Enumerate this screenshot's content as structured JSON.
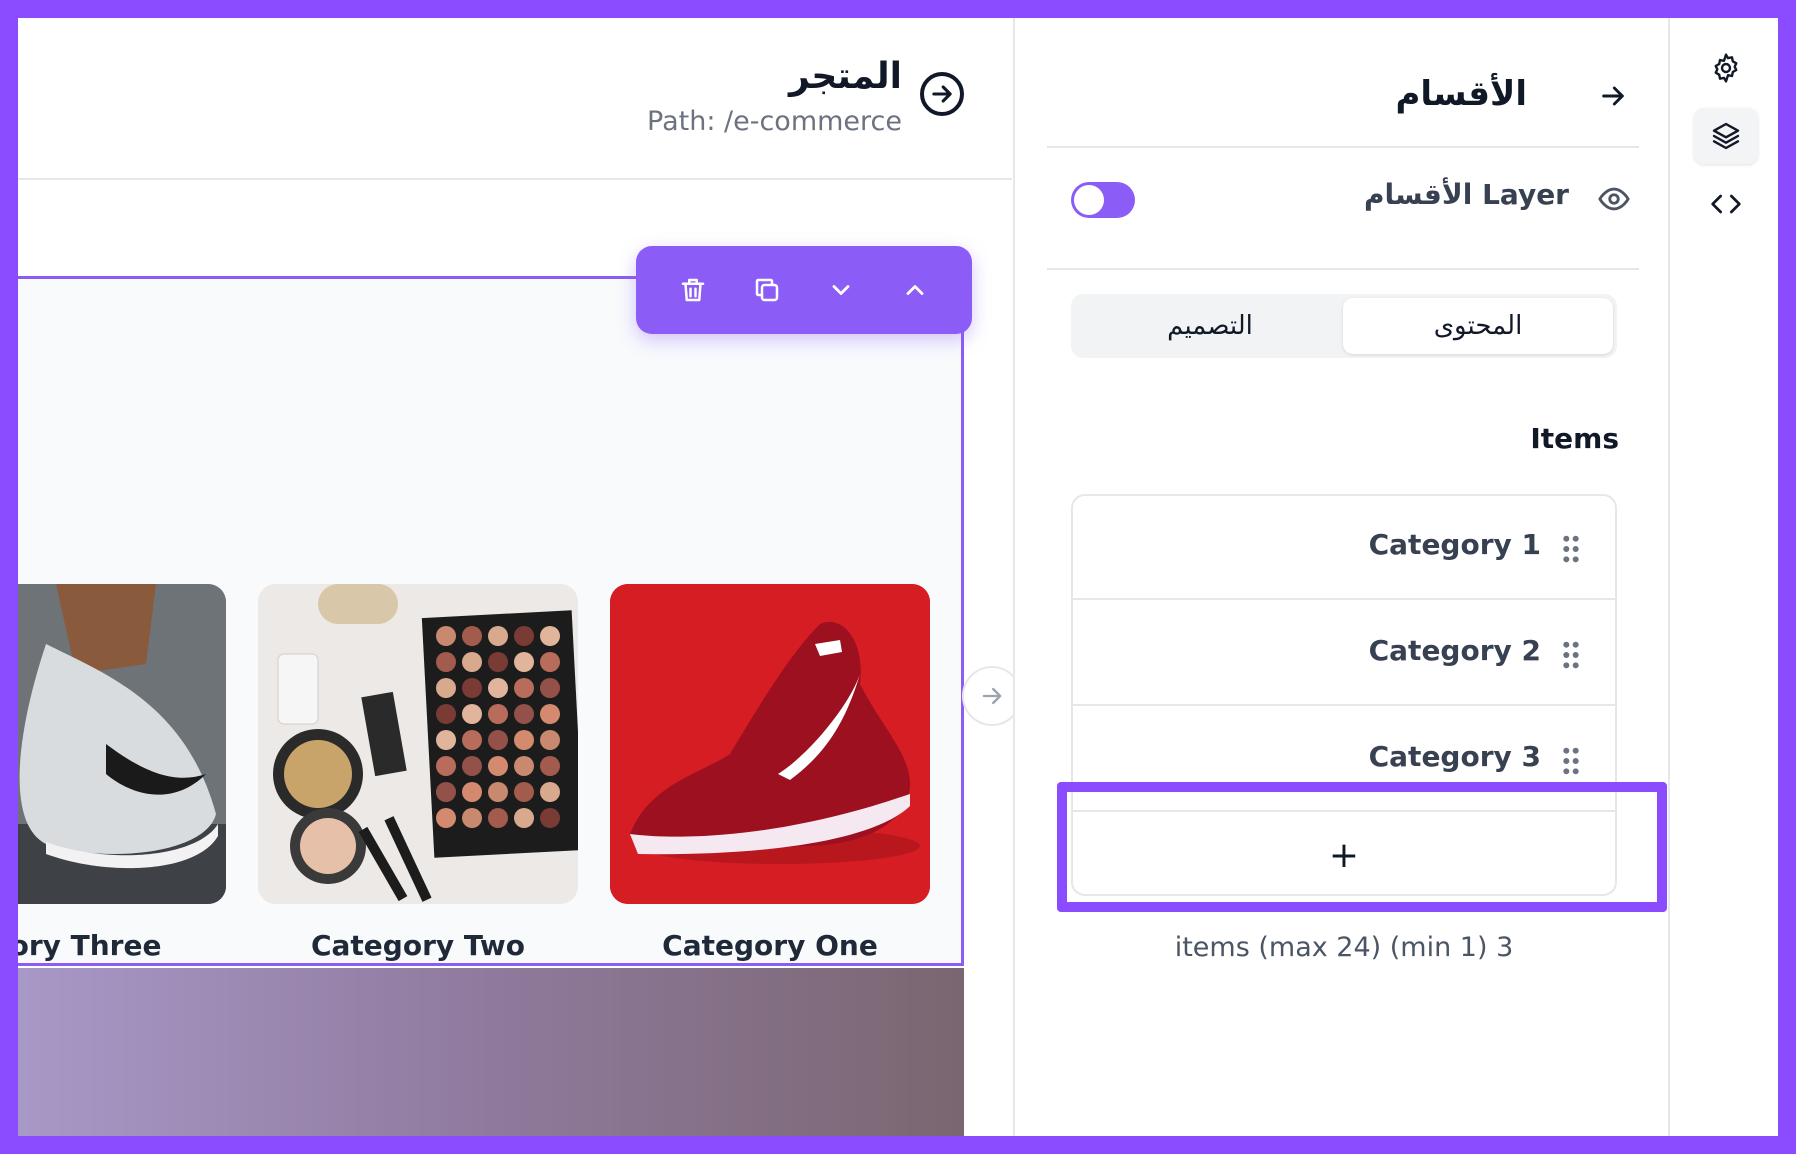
{
  "header": {
    "title": "المتجر",
    "path": "Path: /e-commerce"
  },
  "toolbar": {
    "icons": [
      "trash-icon",
      "copy-icon",
      "chevron-down-icon",
      "chevron-up-icon"
    ]
  },
  "categories": [
    {
      "label": "Category One",
      "image": "red-sneaker"
    },
    {
      "label": "Category Two",
      "image": "makeup-palette"
    },
    {
      "label": "egory Three",
      "image": "gray-sneaker"
    }
  ],
  "panel": {
    "title": "الأقسام",
    "layer_label": "Layer الأقسام",
    "toggle_on": true,
    "tabs": [
      {
        "label": "المحتوى",
        "active": true
      },
      {
        "label": "التصميم",
        "active": false
      }
    ],
    "items_label": "Items",
    "items": [
      {
        "label": "Category 1"
      },
      {
        "label": "Category 2"
      },
      {
        "label": "Category 3"
      }
    ],
    "add_label": "+",
    "count_note": "items (max 24) (min 1) 3"
  },
  "rail": {
    "icons": [
      "gear-icon",
      "layers-icon",
      "code-icon"
    ],
    "active": "layers-icon"
  },
  "colors": {
    "accent": "#8b5cf6",
    "frame": "#8b4bff"
  }
}
